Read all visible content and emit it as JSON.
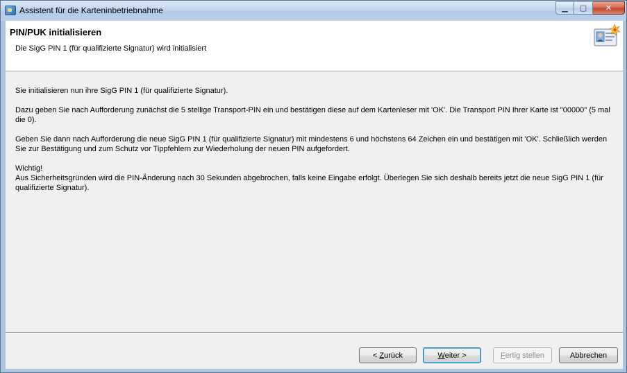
{
  "window": {
    "title": "Assistent für die Karteninbetriebnahme",
    "min_symbol": "▁",
    "max_symbol": "▢",
    "close_symbol": "✕"
  },
  "header": {
    "title": "PIN/PUK initialisieren",
    "subtitle": "Die SigG PIN 1 (für qualifizierte Signatur) wird initialisiert"
  },
  "body": {
    "p1": "Sie initialisieren nun ihre SigG PIN 1 (für qualifizierte Signatur).",
    "p2": "Dazu geben Sie nach Aufforderung zunächst die 5 stellige Transport-PIN ein und bestätigen diese auf dem Kartenleser mit 'OK'. Die Transport PIN Ihrer Karte ist \"00000\" (5 mal die 0).",
    "p3": "Geben Sie dann nach Aufforderung die neue SigG PIN 1 (für qualifizierte Signatur) mit mindestens 6 und höchstens 64 Zeichen ein und bestätigen mit 'OK'. Schließlich werden Sie zur Bestätigung und zum Schutz vor Tippfehlern zur Wiederholung der neuen PIN aufgefordert.",
    "warning_title": "Wichtig!",
    "warning_text": "Aus Sicherheitsgründen wird die PIN-Änderung nach 30 Sekunden abgebrochen, falls keine Eingabe erfolgt. Überlegen Sie sich deshalb bereits jetzt die neue SigG PIN 1 (für qualifizierte Signatur)."
  },
  "buttons": {
    "back_prefix": "< ",
    "back_mnemonic": "Z",
    "back_rest": "urück",
    "next_mnemonic": "W",
    "next_rest": "eiter >",
    "finish_mnemonic": "F",
    "finish_rest": "ertig stellen",
    "cancel": "Abbrechen"
  }
}
